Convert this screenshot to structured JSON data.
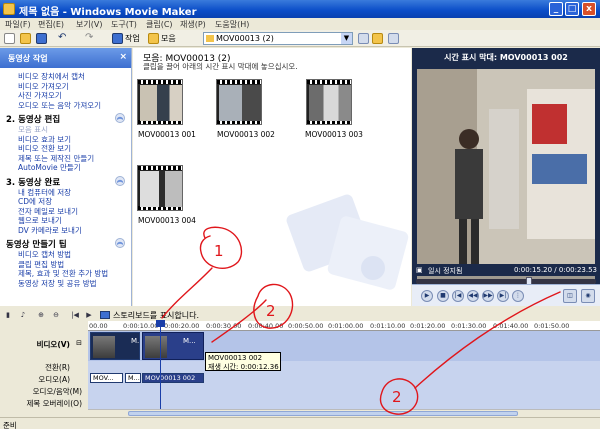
{
  "window": {
    "title": "제목 없음 - Windows Movie Maker",
    "min": "_",
    "max": "□",
    "close": "x"
  },
  "menu": [
    "파일(F)",
    "편집(E)",
    "보기(V)",
    "도구(T)",
    "클립(C)",
    "재생(P)",
    "도움말(H)"
  ],
  "toolbar": {
    "tasks_label": "작업",
    "collections_label": "모음",
    "collection_value": "MOV00013 (2)"
  },
  "tasks": {
    "header": "동영상 작업",
    "sections": [
      {
        "title": "",
        "items": [
          {
            "label": "비디오 장치에서 캡처",
            "disabled": false
          },
          {
            "label": "비디오 가져오기",
            "disabled": false
          },
          {
            "label": "사진 가져오기",
            "disabled": false
          },
          {
            "label": "오디오 또는 음악 가져오기",
            "disabled": false
          }
        ]
      },
      {
        "title": "2. 동영상 편집",
        "items": [
          {
            "label": "모음 표시",
            "disabled": true
          },
          {
            "label": "비디오 효과 보기",
            "disabled": false
          },
          {
            "label": "비디오 전환 보기",
            "disabled": false
          },
          {
            "label": "제목 또는 제작진 만들기",
            "disabled": false
          },
          {
            "label": "AutoMovie 만들기",
            "disabled": false
          }
        ]
      },
      {
        "title": "3. 동영상 완료",
        "items": [
          {
            "label": "내 컴퓨터에 저장",
            "disabled": false
          },
          {
            "label": "CD에 저장",
            "disabled": false
          },
          {
            "label": "전자 메일로 보내기",
            "disabled": false
          },
          {
            "label": "웹으로 보내기",
            "disabled": false
          },
          {
            "label": "DV 카메라로 보내기",
            "disabled": false
          }
        ]
      },
      {
        "title": "동영상 만들기 팁",
        "items": [
          {
            "label": "비디오 캡처 방법",
            "disabled": false
          },
          {
            "label": "클립 편집 방법",
            "disabled": false
          },
          {
            "label": "제목, 효과 및 전환 추가 방법",
            "disabled": false
          },
          {
            "label": "동영상 저장 및 공유 방법",
            "disabled": false
          }
        ]
      }
    ]
  },
  "collection": {
    "title": "모음: MOV00013 (2)",
    "subtitle": "클립을 끌어 아래의 시간 표시 막대에 놓으십시오.",
    "clips": [
      "MOV00013 001",
      "MOV00013 002",
      "MOV00013 003",
      "MOV00013 004"
    ]
  },
  "preview": {
    "title": "시간 표시 막대: MOV00013 002",
    "status": "일시 정지됨",
    "time": "0:00:15.20 / 0:00:23.53"
  },
  "timeline": {
    "storyboard_toggle": "스토리보드를 표시합니다.",
    "ruler": [
      "00.00",
      "0:00:10.00",
      "0:00:20.00",
      "0:00:30.00",
      "0:00:40.00",
      "0:00:50.00",
      "0:01:00.00",
      "0:01:10.00",
      "0:01:20.00",
      "0:01:30.00",
      "0:01:40.00",
      "0:01:50.00"
    ],
    "tracks": {
      "video": "비디오(V)",
      "transition": "전환(R)",
      "audio": "오디오(A)",
      "music": "오디오/음악(M)",
      "title": "제목 오버레이(O)"
    },
    "video_clips": [
      "M...",
      "M..."
    ],
    "audio_clips": [
      "MOV...",
      "M...",
      "MOV00013 002"
    ],
    "tooltip": {
      "line1": "MOV00013 002",
      "line2": "재생 시간: 0:00:12.36"
    }
  },
  "statusbar": "준비",
  "annotations": [
    "1",
    "2",
    "2"
  ],
  "colors": {
    "accent": "#3d6fd0",
    "annotation": "#e0161b",
    "preview_bg": "#1b2a4a"
  }
}
